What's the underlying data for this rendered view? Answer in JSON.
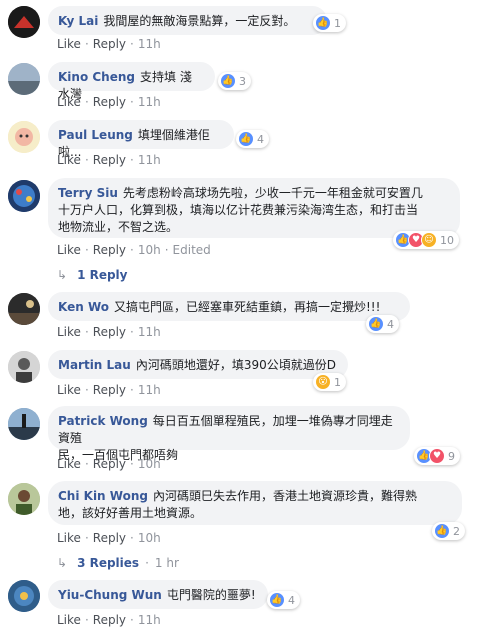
{
  "actions": {
    "like": "Like",
    "reply": "Reply",
    "dot": "·"
  },
  "comments": [
    {
      "name": "Ky Lai",
      "text": "我間屋的無敵海景點算，一定反對。",
      "time": "11h",
      "count": "1"
    },
    {
      "name": "Kino Cheng",
      "text": "支持填 淺水灣",
      "time": "11h",
      "count": "3"
    },
    {
      "name": "Paul Leung",
      "text": "填埋個維港佢啦...",
      "time": "11h",
      "count": "4"
    },
    {
      "name": "Terry Siu",
      "text_line1": "先考虑粉岭高球场先啦，少收一千元一年租金就可安置几",
      "text_line2": "十万户人口，化算到极，填海以亿计花费兼污染海湾生态，和打击当",
      "text_line3": "地物流业，不智之选。",
      "time": "10h",
      "edited": "Edited",
      "count": "10"
    },
    {
      "name": "Ken Wo",
      "text_line1": "又搞屯門區，已經塞車死結重鎮，再搞一定攪炒!!!",
      "time": "11h",
      "count": "4"
    },
    {
      "name": "Martin Lau",
      "text": "內河碼頭地還好，填390公頃就過份D",
      "time": "11h",
      "count": "1"
    },
    {
      "name": "Patrick Wong",
      "text_line1": "每日百五個單程殖民，加埋一堆偽專才同埋走資殖",
      "text_line2": "民，一百個屯門都唔夠",
      "time": "10h",
      "count": "9"
    },
    {
      "name": "Chi Kin Wong",
      "text_line1": "內河碼頭巳失去作用，香港土地資源珍貴，難得熟",
      "text_line2": "地，該好好善用土地資源。",
      "time": "10h",
      "count": "2"
    },
    {
      "name": "Yiu-Chung Wun",
      "text": "屯門醫院的噩夢!",
      "time": "11h",
      "count": "4"
    }
  ],
  "replies": [
    {
      "label": "1 Reply",
      "time": ""
    },
    {
      "label": "3 Replies",
      "time": "1 hr"
    }
  ],
  "colors": {
    "link": "#385898",
    "bubble": "#f2f3f5",
    "meta": "#90949c"
  }
}
